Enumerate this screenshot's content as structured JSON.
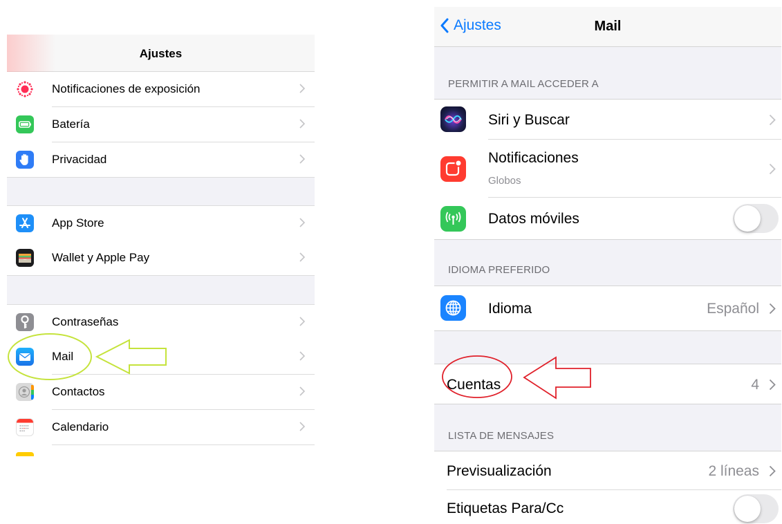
{
  "left": {
    "title": "Ajustes",
    "groups": [
      [
        {
          "label": "Notificaciones de exposición",
          "icon": "exposure-notifications-icon"
        },
        {
          "label": "Batería",
          "icon": "battery-icon"
        },
        {
          "label": "Privacidad",
          "icon": "privacy-hand-icon"
        }
      ],
      [
        {
          "label": "App Store",
          "icon": "app-store-icon"
        },
        {
          "label": "Wallet y Apple Pay",
          "icon": "wallet-icon"
        }
      ],
      [
        {
          "label": "Contraseñas",
          "icon": "key-icon"
        },
        {
          "label": "Mail",
          "icon": "mail-icon"
        },
        {
          "label": "Contactos",
          "icon": "contacts-icon"
        },
        {
          "label": "Calendario",
          "icon": "calendar-icon"
        }
      ]
    ]
  },
  "right": {
    "back_label": "Ajustes",
    "title": "Mail",
    "section_access": "PERMITIR A MAIL ACCEDER A",
    "siri_label": "Siri y Buscar",
    "notifications_label": "Notificaciones",
    "notifications_sub": "Globos",
    "cellular_label": "Datos móviles",
    "cellular_on": false,
    "section_language": "IDIOMA PREFERIDO",
    "language_label": "Idioma",
    "language_value": "Español",
    "accounts_label": "Cuentas",
    "accounts_value": "4",
    "section_messages": "LISTA DE MENSAJES",
    "preview_label": "Previsualización",
    "preview_value": "2 líneas",
    "tocc_label": "Etiquetas Para/Cc",
    "tocc_on": false
  },
  "colors": {
    "accent": "#0a7aff",
    "annotation_green": "#c5e33c",
    "annotation_red": "#e0202a"
  }
}
